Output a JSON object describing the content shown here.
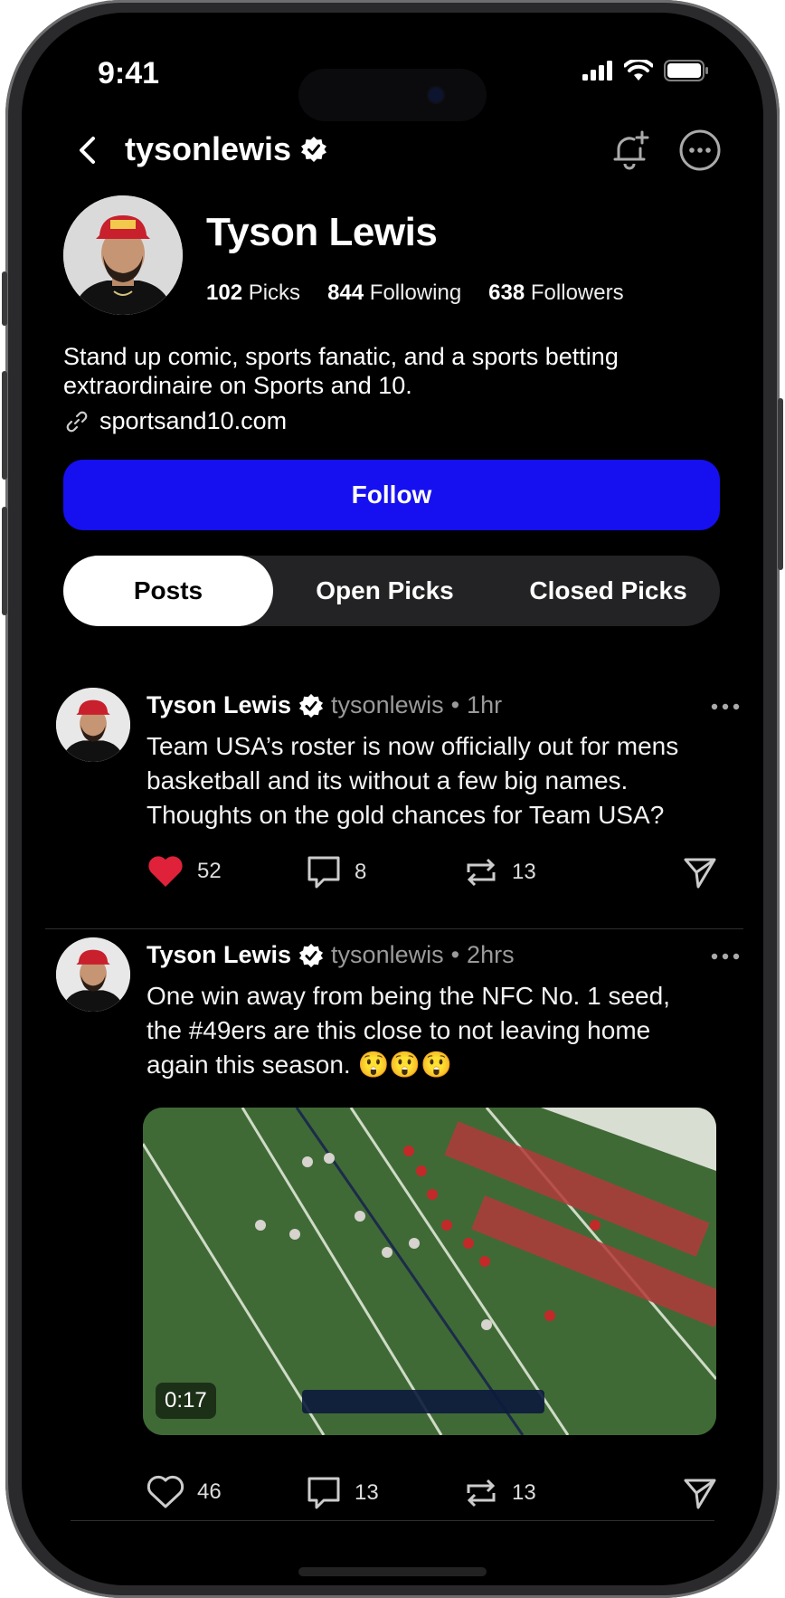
{
  "status_bar": {
    "time": "9:41"
  },
  "header": {
    "handle": "tysonlewis"
  },
  "profile": {
    "name": "Tyson Lewis",
    "stats": [
      {
        "count": "102",
        "label": "Picks"
      },
      {
        "count": "844",
        "label": "Following"
      },
      {
        "count": "638",
        "label": "Followers"
      }
    ],
    "bio": "Stand up comic, sports fanatic, and a sports betting extraordinaire on Sports and 10.",
    "link": "sportsand10.com",
    "follow_label": "Follow"
  },
  "tabs": [
    {
      "label": "Posts",
      "active": true
    },
    {
      "label": "Open Picks",
      "active": false
    },
    {
      "label": "Closed Picks",
      "active": false
    }
  ],
  "posts": [
    {
      "author": "Tyson Lewis",
      "handle": "tysonlewis",
      "separator": "•",
      "time": "1hr",
      "text": "Team USA’s roster is now officially out for mens basketball and its without a few big names. Thoughts on the gold chances for Team USA?",
      "likes": "52",
      "liked": true,
      "comments": "8",
      "reposts": "13"
    },
    {
      "author": "Tyson Lewis",
      "handle": "tysonlewis",
      "separator": "•",
      "time": "2hrs",
      "text": "One win away from being the NFC No. 1 seed, the #49ers are this close to not leaving home again this season. 😲😲😲",
      "video_duration": "0:17",
      "likes": "46",
      "liked": false,
      "comments": "13",
      "reposts": "13"
    }
  ],
  "colors": {
    "accent": "#1610f0",
    "like": "#e0213a",
    "background": "#000000"
  }
}
